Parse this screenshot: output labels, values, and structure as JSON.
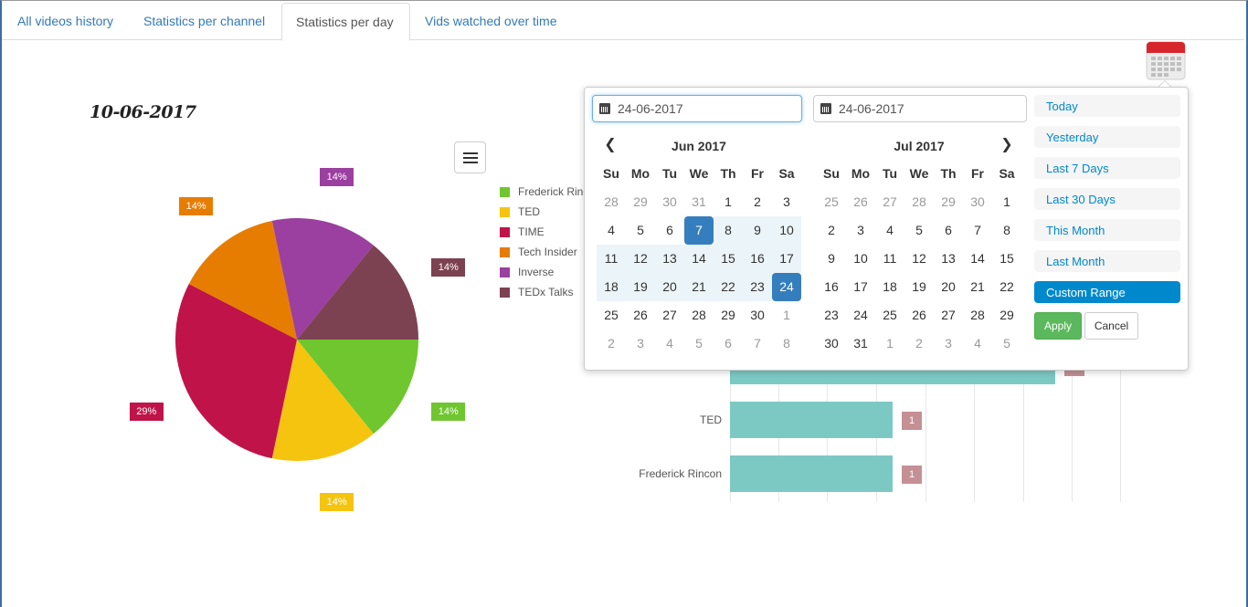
{
  "tabs": [
    {
      "label": "All videos history"
    },
    {
      "label": "Statistics per channel"
    },
    {
      "label": "Statistics per day",
      "active": true
    },
    {
      "label": "Vids watched over time"
    }
  ],
  "day_title": "10-06-2017",
  "chart_data": [
    {
      "type": "pie",
      "slices": [
        {
          "name": "Frederick Rincon",
          "value": 14,
          "color": "#6fc62f"
        },
        {
          "name": "TED",
          "value": 14,
          "color": "#f4c40f"
        },
        {
          "name": "TIME",
          "value": 29,
          "color": "#c0134a"
        },
        {
          "name": "Tech Insider",
          "value": 14,
          "color": "#e67d00"
        },
        {
          "name": "Inverse",
          "value": 14,
          "color": "#9b3fa0"
        },
        {
          "name": "TEDx Talks",
          "value": 14,
          "color": "#7d4251"
        }
      ],
      "slice_labels": [
        "14%",
        "14%",
        "29%",
        "14%",
        "14%",
        "14%"
      ],
      "legend": [
        "Frederick Rinc",
        "TED",
        "TIME",
        "Tech Insider",
        "Inverse",
        "TEDx Talks"
      ],
      "legend_position": "right"
    },
    {
      "type": "bar",
      "orientation": "horizontal",
      "categories": [
        "TED",
        "Frederick Rincon"
      ],
      "values": [
        1,
        1
      ],
      "value_labels": [
        "1",
        "1"
      ],
      "partial_bar_visible_value": 2,
      "bar_color": "#7cc9c4",
      "label_color": "#c59094"
    }
  ],
  "daterange": {
    "start_input": "24-06-2017",
    "end_input": "24-06-2017",
    "left_month": "Jun 2017",
    "right_month": "Jul 2017",
    "prev_icon": "chevron-left-icon",
    "next_icon": "chevron-right-icon",
    "weekdays": [
      "Su",
      "Mo",
      "Tu",
      "We",
      "Th",
      "Fr",
      "Sa"
    ],
    "left_days": [
      [
        "28",
        "29",
        "30",
        "31",
        "1",
        "2",
        "3"
      ],
      [
        "4",
        "5",
        "6",
        "7",
        "8",
        "9",
        "10"
      ],
      [
        "11",
        "12",
        "13",
        "14",
        "15",
        "16",
        "17"
      ],
      [
        "18",
        "19",
        "20",
        "21",
        "22",
        "23",
        "24"
      ],
      [
        "25",
        "26",
        "27",
        "28",
        "29",
        "30",
        "1"
      ],
      [
        "2",
        "3",
        "4",
        "5",
        "6",
        "7",
        "8"
      ]
    ],
    "right_days": [
      [
        "25",
        "26",
        "27",
        "28",
        "29",
        "30",
        "1"
      ],
      [
        "2",
        "3",
        "4",
        "5",
        "6",
        "7",
        "8"
      ],
      [
        "9",
        "10",
        "11",
        "12",
        "13",
        "14",
        "15"
      ],
      [
        "16",
        "17",
        "18",
        "19",
        "20",
        "21",
        "22"
      ],
      [
        "23",
        "24",
        "25",
        "26",
        "27",
        "28",
        "29"
      ],
      [
        "30",
        "31",
        "1",
        "2",
        "3",
        "4",
        "5"
      ]
    ],
    "ranges": [
      "Today",
      "Yesterday",
      "Last 7 Days",
      "Last 30 Days",
      "This Month",
      "Last Month",
      "Custom Range"
    ],
    "active_range": "Custom Range",
    "apply_label": "Apply",
    "cancel_label": "Cancel"
  },
  "colors": {
    "link": "#337ab7",
    "selected_day": "#357ebd",
    "range_fill": "#ebf4f8",
    "range_active": "#0088cc",
    "apply": "#5cb85c"
  }
}
